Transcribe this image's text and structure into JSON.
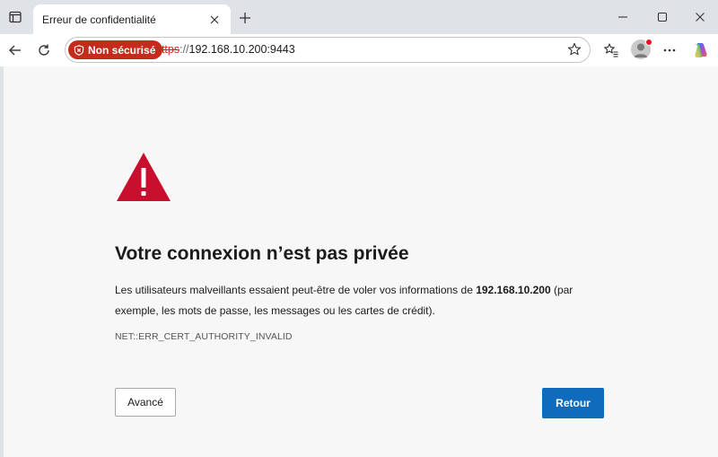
{
  "tab": {
    "title": "Erreur de confidentialité"
  },
  "address_bar": {
    "security_label": "Non sécurisé",
    "url_scheme": "https",
    "url_separator": "://",
    "url_host": "192.168.10.200:9443"
  },
  "page": {
    "headline": "Votre connexion n’est pas privée",
    "description_prefix": "Les utilisateurs malveillants essaient peut-être de voler vos informations de ",
    "description_host": "192.168.10.200",
    "description_suffix": " (par exemple, les mots de passe, les messages ou les cartes de crédit).",
    "error_code": "NET::ERR_CERT_AUTHORITY_INVALID",
    "advanced_button": "Avancé",
    "back_button": "Retour"
  },
  "icons": {
    "warning": "warning-triangle-icon",
    "not_secure": "shield-x-icon",
    "copilot": "copilot-icon"
  },
  "colors": {
    "warning_red": "#c8102e",
    "not_secure_red": "#c42b1c",
    "primary_blue": "#0f6cbd",
    "content_bg": "#f7f7f7",
    "frame_bg": "#dfe3e8"
  }
}
